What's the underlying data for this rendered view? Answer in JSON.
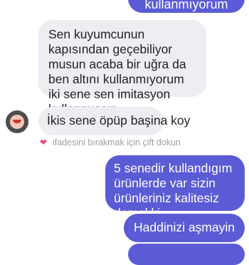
{
  "conversation": {
    "outgoing_top_partial": "kullanmıyorum",
    "incoming_1": "Sen kuyumcunun kapısından geçebiliyor musun acaba bir uğra da ben altını kullanmıyorum iki sene sen imitasyon kullanmışsın",
    "incoming_2": "İkis sene öpüp başina koy",
    "double_tap_hint": "ifadesini bırakmak için çift dokun",
    "outgoing_1": "5 senedir kullandıgım ürünlerde var sizin ürünleriniz kalitesiz demekki",
    "outgoing_2": "Haddinizi aşmayin"
  },
  "icons": {
    "heart": "heart-icon",
    "avatar": "avatar"
  },
  "colors": {
    "outgoing_bubble": "#5b5bd6",
    "incoming_bubble": "#eceef1",
    "heart": "#e9497a"
  }
}
